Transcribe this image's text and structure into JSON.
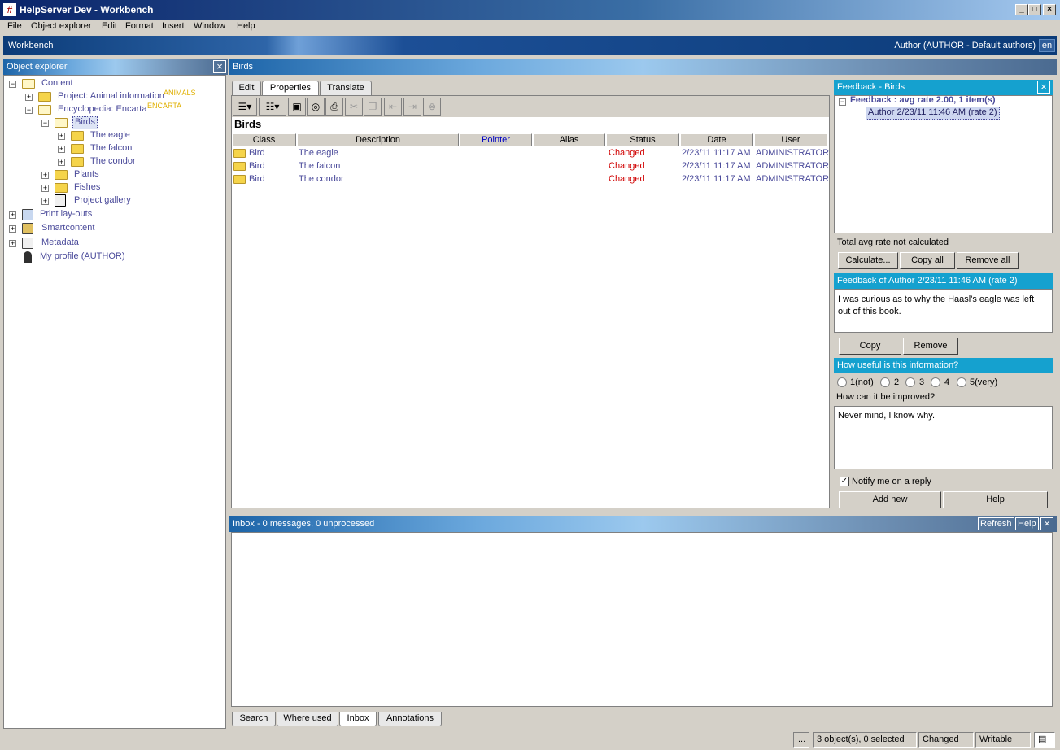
{
  "window": {
    "title": "HelpServer Dev - Workbench",
    "app_icon": "#"
  },
  "menu": [
    "File",
    "Object explorer",
    "Edit",
    "Format",
    "Insert",
    "Window",
    "Help"
  ],
  "workbench": {
    "label": "Workbench",
    "author": "Author (AUTHOR - Default authors)",
    "lang": "en"
  },
  "explorer": {
    "title": "Object explorer",
    "items": [
      "Content",
      "Project: Animal information",
      "Encyclopedia: Encarta",
      "Birds",
      "The eagle",
      "The falcon",
      "The condor",
      "Plants",
      "Fishes",
      "Project gallery",
      "Print lay-outs",
      "Smartcontent",
      "Metadata",
      "My profile (AUTHOR)"
    ],
    "tags": {
      "animals": "ANIMALS",
      "encarta": "ENCARTA"
    }
  },
  "doc": {
    "title": "Birds",
    "tabs": [
      "Edit",
      "Properties",
      "Translate"
    ],
    "heading": "Birds",
    "columns": [
      "Class",
      "Description",
      "Pointer",
      "Alias",
      "Status",
      "Date",
      "User"
    ],
    "rows": [
      [
        "Bird",
        "The eagle",
        "",
        "",
        "Changed",
        "2/23/11 11:17 AM",
        "ADMINISTRATOR"
      ],
      [
        "Bird",
        "The falcon",
        "",
        "",
        "Changed",
        "2/23/11 11:17 AM",
        "ADMINISTRATOR"
      ],
      [
        "Bird",
        "The condor",
        "",
        "",
        "Changed",
        "2/23/11 11:17 AM",
        "ADMINISTRATOR"
      ]
    ]
  },
  "feedback": {
    "title": "Feedback - Birds",
    "root": "Feedback : avg rate 2.00, 1 item(s)",
    "child": "Author 2/23/11 11:46 AM (rate 2)",
    "total": "Total avg rate not calculated",
    "buttons": [
      "Calculate...",
      "Copy all",
      "Remove all"
    ],
    "detail_title": "Feedback of Author 2/23/11 11:46 AM (rate 2)",
    "detail_text": "I was curious as to why the Haasl's eagle was left out of this book.",
    "detail_buttons": [
      "Copy",
      "Remove"
    ],
    "question": "How useful is this information?",
    "ratings": [
      "1(not)",
      "2",
      "3",
      "4",
      "5(very)"
    ],
    "improve_label": "How can it be improved?",
    "improve_text": "Never mind, I know why.",
    "notify": "Notify me on a reply",
    "bottom_buttons": [
      "Add new",
      "Help"
    ]
  },
  "inbox": {
    "title": "Inbox - 0 messages, 0 unprocessed",
    "refresh": "Refresh",
    "help": "Help",
    "tabs": [
      "Search",
      "Where used",
      "Inbox",
      "Annotations"
    ]
  },
  "status": {
    "dots": "...",
    "selection": "3 object(s), 0 selected",
    "state": "Changed",
    "mode": "Writable"
  }
}
